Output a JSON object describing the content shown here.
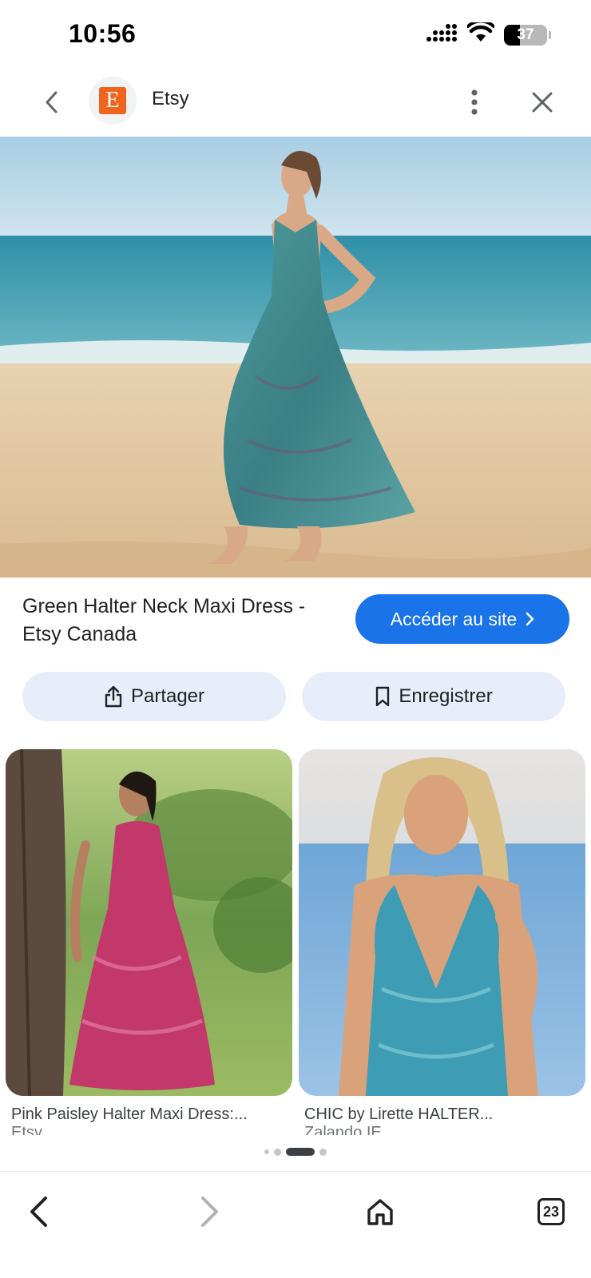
{
  "status_bar": {
    "time": "10:56",
    "battery_percent": 37,
    "battery_label": "37"
  },
  "top_bar": {
    "site_logo_letter": "E",
    "site_name": "Etsy",
    "logo_color": "#f1641e"
  },
  "product": {
    "title": "Green Halter Neck Maxi Dress - Etsy Canada",
    "visit_label": "Accéder au site",
    "share_label": "Partager",
    "save_label": "Enregistrer"
  },
  "results": [
    {
      "title": "Pink Paisley Halter Maxi Dress:...",
      "source": "Etsy"
    },
    {
      "title": "CHIC by Lirette HALTER...",
      "source": "Zalando IE"
    }
  ],
  "pagination": {
    "total": 4,
    "active_index": 2
  },
  "bottom_nav": {
    "tab_count": "23"
  },
  "colors": {
    "accent": "#1a73e8",
    "action_button_bg": "#e8eef9"
  }
}
